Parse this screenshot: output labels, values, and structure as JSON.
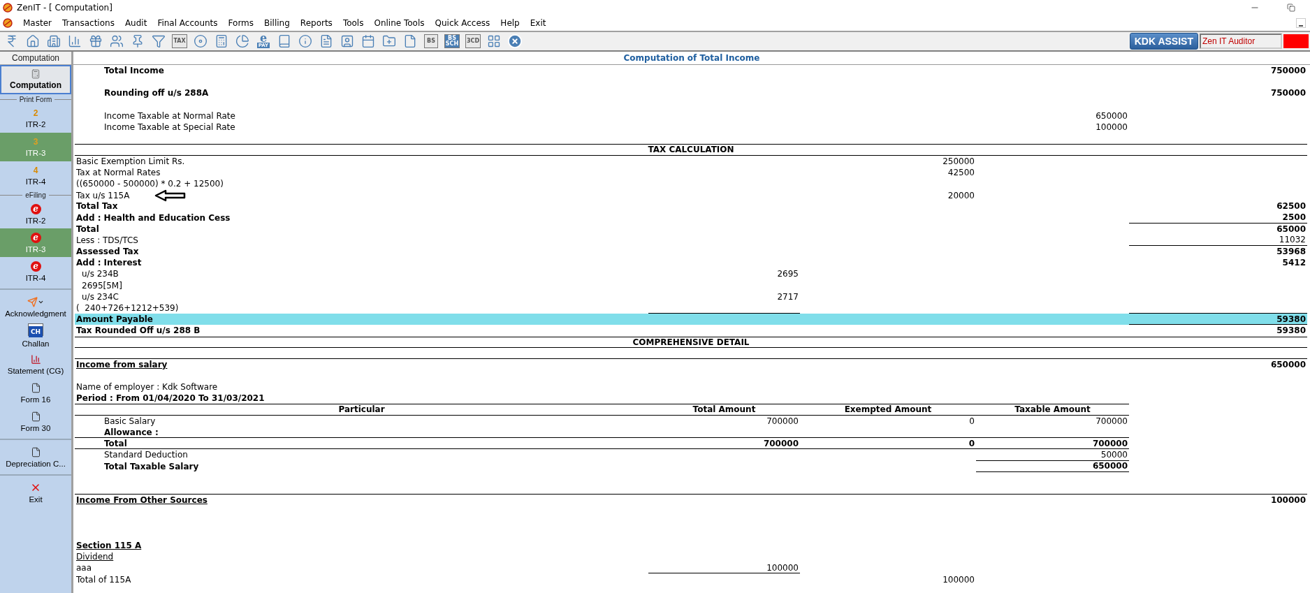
{
  "window": {
    "title": "ZenIT - [ Computation]"
  },
  "menu": [
    "Master",
    "Transactions",
    "Audit",
    "Final Accounts",
    "Forms",
    "Billing",
    "Reports",
    "Tools",
    "Online Tools",
    "Quick Access",
    "Help",
    "Exit"
  ],
  "toolbar": [
    {
      "kind": "rupee"
    },
    {
      "kind": "home"
    },
    {
      "kind": "building"
    },
    {
      "kind": "chart"
    },
    {
      "kind": "gift"
    },
    {
      "kind": "users"
    },
    {
      "kind": "pin"
    },
    {
      "kind": "filter"
    },
    {
      "kind": "tile",
      "label": "TAX"
    },
    {
      "kind": "disc"
    },
    {
      "kind": "calculator"
    },
    {
      "kind": "pie"
    },
    {
      "kind": "pay",
      "glyph": "e",
      "label": "PAY"
    },
    {
      "kind": "book"
    },
    {
      "kind": "info"
    },
    {
      "kind": "report"
    },
    {
      "kind": "user-doc"
    },
    {
      "kind": "calendar"
    },
    {
      "kind": "folder-plus"
    },
    {
      "kind": "doc"
    },
    {
      "kind": "tile",
      "label": "BS"
    },
    {
      "kind": "tile2",
      "label": "BS",
      "sublabel": "SCH"
    },
    {
      "kind": "tile",
      "label": "3CD"
    },
    {
      "kind": "grid"
    },
    {
      "kind": "close"
    }
  ],
  "assist_button": "KDK ASSIST",
  "user_field": {
    "value": "Zen IT Auditor"
  },
  "sidebar": {
    "tab": "Computation",
    "current": {
      "label": "Computation",
      "selected": true
    },
    "groups": [
      {
        "title": "Print Form",
        "items": [
          {
            "kind": "print",
            "badge": "2",
            "label": "ITR-2",
            "selected": false
          },
          {
            "kind": "print",
            "badge": "3",
            "label": "ITR-3",
            "selected": true
          },
          {
            "kind": "print",
            "badge": "4",
            "label": "ITR-4",
            "selected": false
          }
        ]
      },
      {
        "title": "eFiling",
        "items": [
          {
            "kind": "efile",
            "badge": "e",
            "label": "ITR-2",
            "selected": false
          },
          {
            "kind": "efile",
            "badge": "e",
            "label": "ITR-3",
            "selected": true
          },
          {
            "kind": "efile",
            "badge": "e",
            "label": "ITR-4",
            "selected": false
          }
        ]
      },
      {
        "items": [
          {
            "kind": "acknowledgment",
            "label": "Acknowledgment",
            "selected": false
          },
          {
            "kind": "challan",
            "badge": "CH",
            "label": "Challan",
            "selected": false
          },
          {
            "kind": "statement",
            "label": "Statement (CG)",
            "selected": false
          },
          {
            "kind": "form",
            "label": "Form 16",
            "selected": false
          },
          {
            "kind": "form",
            "label": "Form 30",
            "selected": false
          }
        ]
      },
      {
        "items": [
          {
            "kind": "form",
            "label": "Depreciation C...",
            "selected": false
          }
        ]
      },
      {
        "items": [
          {
            "kind": "exit",
            "label": "Exit",
            "selected": false
          }
        ]
      }
    ]
  },
  "report": {
    "title": "Computation of Total Income",
    "rows": [
      {
        "kind": "indented-bold",
        "label": "Total Income",
        "column_4": "750000"
      },
      {
        "kind": "blank"
      },
      {
        "kind": "indented-bold",
        "label": "Rounding off u/s 288A",
        "column_4": "750000"
      },
      {
        "kind": "blank"
      },
      {
        "kind": "indented",
        "label": "Income Taxable at Normal Rate",
        "column_3": "650000"
      },
      {
        "kind": "indented",
        "label": "Income Taxable at Special Rate",
        "column_3": "100000"
      },
      {
        "kind": "blank"
      },
      {
        "kind": "section",
        "label": "TAX CALCULATION"
      },
      {
        "kind": "plain",
        "label": "Basic Exemption Limit Rs.",
        "column_2": "250000"
      },
      {
        "kind": "plain",
        "label": "Tax at Normal Rates",
        "column_2": "42500"
      },
      {
        "kind": "plain",
        "label": "((650000 - 500000) * 0.2 + 12500)"
      },
      {
        "kind": "plain",
        "label": "Tax u/s 115A",
        "column_2": "20000",
        "annotation_arrow": true
      },
      {
        "kind": "bold",
        "label": "Total Tax",
        "column_4": "62500"
      },
      {
        "kind": "bold",
        "label": "Add : Health and Education Cess",
        "column_4": "2500",
        "rules_below": {
          "column_4": true
        }
      },
      {
        "kind": "bold",
        "label": "Total",
        "column_4": "65000"
      },
      {
        "kind": "plain",
        "label": "Less : TDS/TCS",
        "column_4": "11032",
        "rules_below": {
          "column_4": true
        }
      },
      {
        "kind": "bold",
        "label": "Assessed Tax",
        "column_4": "53968"
      },
      {
        "kind": "bold",
        "label": "Add : Interest",
        "column_4": "5412"
      },
      {
        "kind": "sub",
        "label": "u/s 234B",
        "column_1": "2695"
      },
      {
        "kind": "sub",
        "label": "2695[5M]"
      },
      {
        "kind": "sub",
        "label": "u/s 234C",
        "column_1": "2717"
      },
      {
        "kind": "plain",
        "label": "(  240+726+1212+539)",
        "rules_below": {
          "column_1": true,
          "column_4": true
        }
      },
      {
        "kind": "highlight",
        "label": "Amount Payable",
        "column_4": "59380",
        "rules_below": {
          "column_4": true
        }
      },
      {
        "kind": "bold",
        "label": "Tax Rounded Off u/s 288 B",
        "column_4": "59380"
      },
      {
        "kind": "section",
        "label": "COMPREHENSIVE DETAIL"
      },
      {
        "kind": "blank",
        "rules_below": {
          "full": true
        }
      },
      {
        "kind": "heading",
        "label": "Income from salary",
        "column_4": "650000"
      },
      {
        "kind": "blank"
      },
      {
        "kind": "plain",
        "label": "Name of employer : Kdk Software"
      },
      {
        "kind": "bold",
        "label": "Period : From 01/04/2020 To 31/03/2021",
        "rules_below": {
          "table": true
        }
      },
      {
        "kind": "table-header",
        "label": "Particular",
        "column_1": "Total Amount",
        "column_2": "Exempted Amount",
        "column_3": "Taxable Amount",
        "rules_below": {
          "table": true
        }
      },
      {
        "kind": "indented",
        "label": "Basic Salary",
        "column_1": "700000",
        "column_2": "0",
        "column_3": "700000"
      },
      {
        "kind": "indented-bold",
        "label": "Allowance :",
        "rules_below": {
          "table": true
        }
      },
      {
        "kind": "indented-bold",
        "label": "Total",
        "column_1": "700000",
        "column_2": "0",
        "column_3": "700000",
        "rules_below": {
          "table": true
        }
      },
      {
        "kind": "indented",
        "label": "Standard Deduction",
        "column_3": "50000",
        "rules_below": {
          "column_3": true
        }
      },
      {
        "kind": "indented-bold",
        "label": "Total Taxable Salary",
        "column_3": "650000",
        "rules_below": {
          "column_3": true
        }
      },
      {
        "kind": "blank"
      },
      {
        "kind": "blank",
        "rules_below": {
          "full": true
        }
      },
      {
        "kind": "heading",
        "label": "Income From Other Sources",
        "column_4": "100000"
      },
      {
        "kind": "blank"
      },
      {
        "kind": "blank"
      },
      {
        "kind": "blank"
      },
      {
        "kind": "heading",
        "label": "Section 115 A"
      },
      {
        "kind": "underlined",
        "label": "Dividend"
      },
      {
        "kind": "plain",
        "label": "aaa",
        "column_1": "100000",
        "rules_below": {
          "column_1": true
        }
      },
      {
        "kind": "plain",
        "label": "Total of 115A",
        "column_2": "100000"
      }
    ]
  }
}
